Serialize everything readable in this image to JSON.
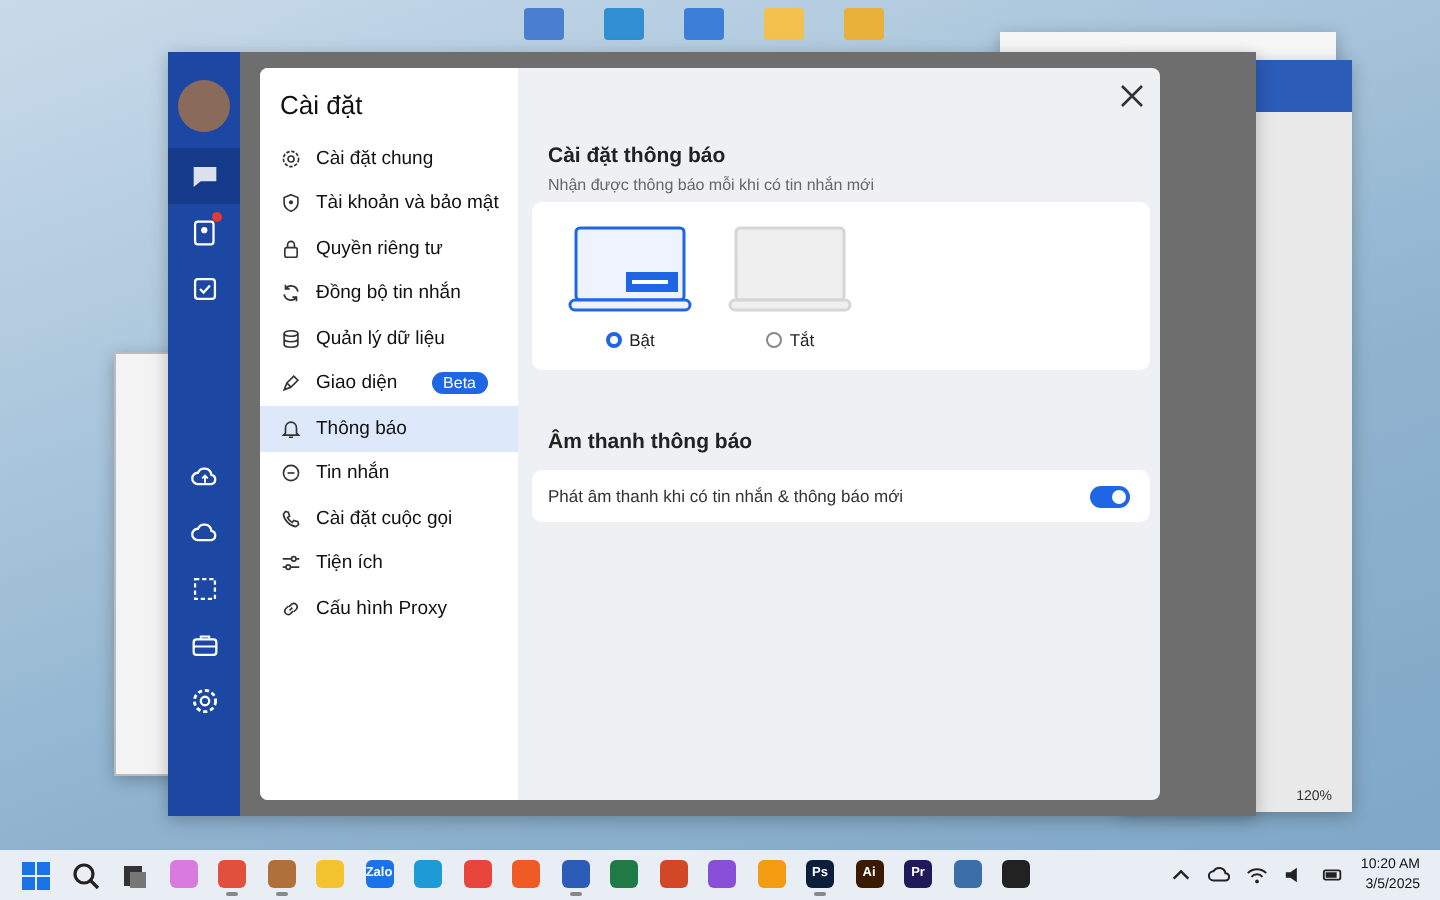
{
  "chat_window": {
    "nav_items": [
      {
        "selected": true,
        "alert": false
      },
      {
        "selected": false,
        "alert": true
      },
      {
        "selected": false,
        "alert": false
      },
      {
        "selected": false,
        "alert": false
      },
      {
        "selected": false,
        "alert": false
      },
      {
        "selected": false,
        "alert": false
      },
      {
        "selected": false,
        "alert": false
      },
      {
        "selected": false,
        "alert": false
      }
    ]
  },
  "word_window": {
    "zoom": "120%"
  },
  "settings": {
    "title": "Cài đặt",
    "menu": [
      {
        "label": "Cài đặt chung",
        "selected": false
      },
      {
        "label": "Tài khoản và bảo mật",
        "selected": false
      },
      {
        "label": "Quyền riêng tư",
        "selected": false
      },
      {
        "label": "Đồng bộ tin nhắn",
        "selected": false
      },
      {
        "label": "Quản lý dữ liệu",
        "selected": false
      },
      {
        "label": "Giao diện",
        "selected": false,
        "badge": "Beta"
      },
      {
        "label": "Thông báo",
        "selected": true
      },
      {
        "label": "Tin nhắn",
        "selected": false
      },
      {
        "label": "Cài đặt cuộc gọi",
        "selected": false
      },
      {
        "label": "Tiện ích",
        "selected": false
      },
      {
        "label": "Cấu hình Proxy",
        "selected": false
      }
    ],
    "notification": {
      "title": "Cài đặt thông báo",
      "subtitle": "Nhận được thông báo mỗi khi có tin nhắn mới",
      "options": [
        {
          "label": "Bật",
          "selected": true
        },
        {
          "label": "Tắt",
          "selected": false
        }
      ]
    },
    "sound": {
      "title": "Âm thanh thông báo",
      "rows": [
        {
          "label": "Phát âm thanh khi có tin nhắn & thông báo mới",
          "on": true
        }
      ]
    }
  },
  "taskbar": {
    "apps": [
      {
        "color": "#d97adf",
        "running": false
      },
      {
        "color": "#e0503c",
        "running": true
      },
      {
        "color": "#b0703c",
        "running": true
      },
      {
        "color": "#f4c430",
        "running": false
      },
      {
        "label": "Zalo",
        "color": "#1a73e8",
        "running": false
      },
      {
        "color": "#1d9bd6",
        "running": false
      },
      {
        "color": "#e8453c",
        "running": false
      },
      {
        "color": "#f05a24",
        "running": false
      },
      {
        "color": "#2b5cb8",
        "running": true
      },
      {
        "color": "#1f7a45",
        "running": false
      },
      {
        "color": "#d24726",
        "running": false
      },
      {
        "color": "#8a4fd8",
        "running": false
      },
      {
        "color": "#f39c12",
        "running": false
      },
      {
        "label": "Ps",
        "color": "#0b1e3a",
        "running": true
      },
      {
        "label": "Ai",
        "color": "#3a1a00",
        "running": false
      },
      {
        "label": "Pr",
        "color": "#1f1a5a",
        "running": false
      },
      {
        "color": "#3c6ea8",
        "running": false
      },
      {
        "color": "#222222",
        "running": false
      }
    ],
    "clock": {
      "time": "10:20 AM",
      "date": "3/5/2025"
    }
  }
}
